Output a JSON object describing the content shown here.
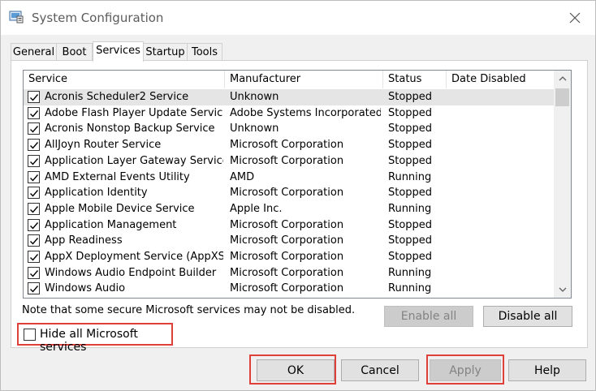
{
  "window": {
    "title": "System Configuration"
  },
  "tabs": [
    {
      "label": "General",
      "active": false
    },
    {
      "label": "Boot",
      "active": false
    },
    {
      "label": "Services",
      "active": true
    },
    {
      "label": "Startup",
      "active": false
    },
    {
      "label": "Tools",
      "active": false
    }
  ],
  "services_table": {
    "columns": [
      "Service",
      "Manufacturer",
      "Status",
      "Date Disabled"
    ],
    "rows": [
      {
        "checked": true,
        "service": "Acronis Scheduler2 Service",
        "manufacturer": "Unknown",
        "status": "Stopped",
        "date_disabled": "",
        "selected": true
      },
      {
        "checked": true,
        "service": "Adobe Flash Player Update Service",
        "manufacturer": "Adobe Systems Incorporated",
        "status": "Stopped",
        "date_disabled": ""
      },
      {
        "checked": true,
        "service": "Acronis Nonstop Backup Service",
        "manufacturer": "Unknown",
        "status": "Stopped",
        "date_disabled": ""
      },
      {
        "checked": true,
        "service": "AllJoyn Router Service",
        "manufacturer": "Microsoft Corporation",
        "status": "Stopped",
        "date_disabled": ""
      },
      {
        "checked": true,
        "service": "Application Layer Gateway Service",
        "manufacturer": "Microsoft Corporation",
        "status": "Stopped",
        "date_disabled": ""
      },
      {
        "checked": true,
        "service": "AMD External Events Utility",
        "manufacturer": "AMD",
        "status": "Running",
        "date_disabled": ""
      },
      {
        "checked": true,
        "service": "Application Identity",
        "manufacturer": "Microsoft Corporation",
        "status": "Stopped",
        "date_disabled": ""
      },
      {
        "checked": true,
        "service": "Apple Mobile Device Service",
        "manufacturer": "Apple Inc.",
        "status": "Running",
        "date_disabled": ""
      },
      {
        "checked": true,
        "service": "Application Management",
        "manufacturer": "Microsoft Corporation",
        "status": "Stopped",
        "date_disabled": ""
      },
      {
        "checked": true,
        "service": "App Readiness",
        "manufacturer": "Microsoft Corporation",
        "status": "Stopped",
        "date_disabled": ""
      },
      {
        "checked": true,
        "service": "AppX Deployment Service (AppXS...",
        "manufacturer": "Microsoft Corporation",
        "status": "Stopped",
        "date_disabled": ""
      },
      {
        "checked": true,
        "service": "Windows Audio Endpoint Builder",
        "manufacturer": "Microsoft Corporation",
        "status": "Running",
        "date_disabled": ""
      },
      {
        "checked": true,
        "service": "Windows Audio",
        "manufacturer": "Microsoft Corporation",
        "status": "Running",
        "date_disabled": ""
      }
    ]
  },
  "note": "Note that some secure Microsoft services may not be disabled.",
  "buttons": {
    "enable_all": "Enable all",
    "disable_all": "Disable all",
    "ok": "OK",
    "cancel": "Cancel",
    "apply": "Apply",
    "help": "Help"
  },
  "hide_microsoft": {
    "label": "Hide all Microsoft services",
    "checked": false
  },
  "colors": {
    "highlight": "#e0403a",
    "selected_row": "#e5e5e5"
  }
}
